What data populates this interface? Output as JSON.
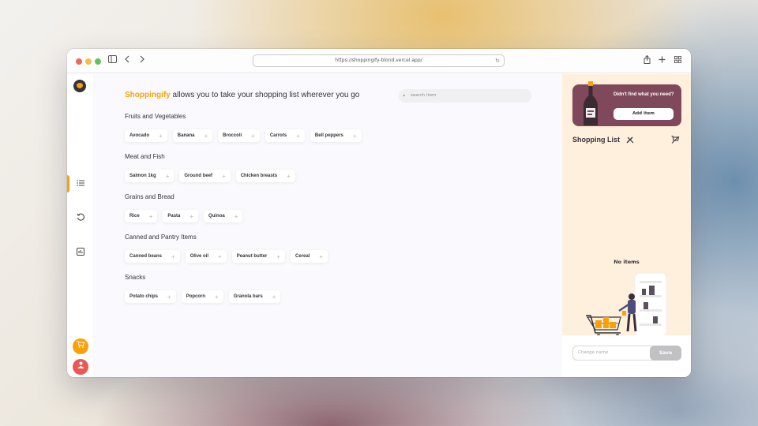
{
  "browser": {
    "url": "https://shoppingify-blond.vercel.app/",
    "back_icon": "chevron-left-icon",
    "forward_icon": "chevron-right-icon",
    "share_icon": "share-icon",
    "new_tab_icon": "plus-icon",
    "tabs_icon": "grid-icon"
  },
  "sidebar": {
    "logo_icon": "bottle-icon",
    "items": [
      {
        "icon": "list-icon",
        "active": true
      },
      {
        "icon": "history-icon",
        "active": false
      },
      {
        "icon": "statistics-icon",
        "active": false
      }
    ],
    "cart_icon": "cart-icon",
    "user_icon": "user-icon"
  },
  "main": {
    "headline_brand": "Shoppingify",
    "headline_rest": " allows you to take your shopping list wherever you go",
    "search_placeholder": "search item",
    "categories": [
      {
        "name": "Fruits and Vegetables",
        "items": [
          "Avocado",
          "Banana",
          "Broccoli",
          "Carrots",
          "Bell peppers"
        ]
      },
      {
        "name": "Meat and Fish",
        "items": [
          "Salmon 1kg",
          "Ground beef",
          "Chicken breasts"
        ]
      },
      {
        "name": "Grains and Bread",
        "items": [
          "Rice",
          "Pasta",
          "Quinoa"
        ]
      },
      {
        "name": "Canned and Pantry Items",
        "items": [
          "Canned beans",
          "Olive oil",
          "Peanut butter",
          "Cereal"
        ]
      },
      {
        "name": "Snacks",
        "items": [
          "Potato chips",
          "Popcorn",
          "Granola bars"
        ]
      }
    ]
  },
  "cart": {
    "banner_text": "Didn't find what you need?",
    "add_item_label": "Add item",
    "list_title": "Shopping List",
    "empty_text": "No items",
    "name_placeholder": "Change name",
    "save_label": "Save",
    "colors": {
      "banner": "#80485b",
      "accent": "#f9a109",
      "panel": "#fff0de"
    }
  }
}
